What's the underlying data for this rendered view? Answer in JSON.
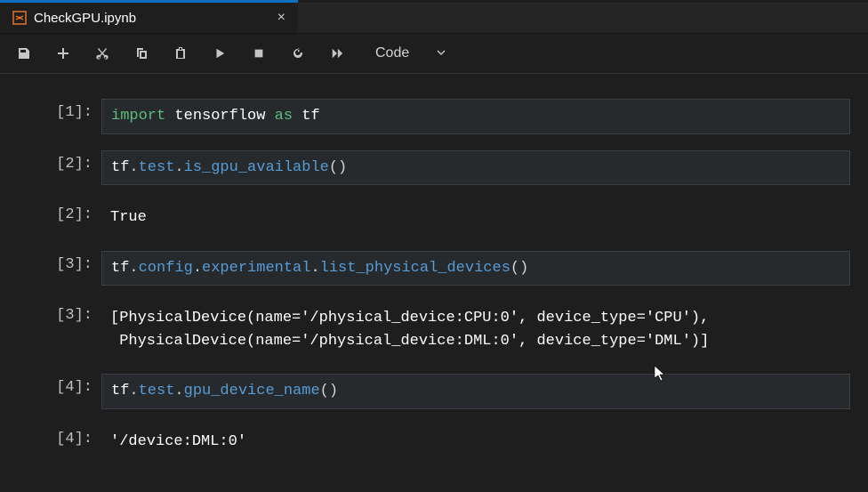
{
  "tab": {
    "title": "CheckGPU.ipynb"
  },
  "toolbar": {
    "cellType": "Code"
  },
  "cells": {
    "c1": {
      "prompt": "[1]:",
      "tok": {
        "import": "import",
        "tensorflow": "tensorflow",
        "as": "as",
        "tf": "tf"
      }
    },
    "c2": {
      "prompt": "[2]:",
      "tok": {
        "tf": "tf",
        "dot1": ".",
        "test": "test",
        "dot2": ".",
        "fn": "is_gpu_available",
        "parens": "()"
      },
      "outPrompt": "[2]:",
      "out": "True"
    },
    "c3": {
      "prompt": "[3]:",
      "tok": {
        "tf": "tf",
        "d1": ".",
        "config": "config",
        "d2": ".",
        "exp": "experimental",
        "d3": ".",
        "fn": "list_physical_devices",
        "parens": "()"
      },
      "outPrompt": "[3]:",
      "out": "[PhysicalDevice(name='/physical_device:CPU:0', device_type='CPU'),\n PhysicalDevice(name='/physical_device:DML:0', device_type='DML')]"
    },
    "c4": {
      "prompt": "[4]:",
      "tok": {
        "tf": "tf",
        "d1": ".",
        "test": "test",
        "d2": ".",
        "fn": "gpu_device_name",
        "parens": "()"
      },
      "outPrompt": "[4]:",
      "out": "'/device:DML:0'"
    }
  }
}
